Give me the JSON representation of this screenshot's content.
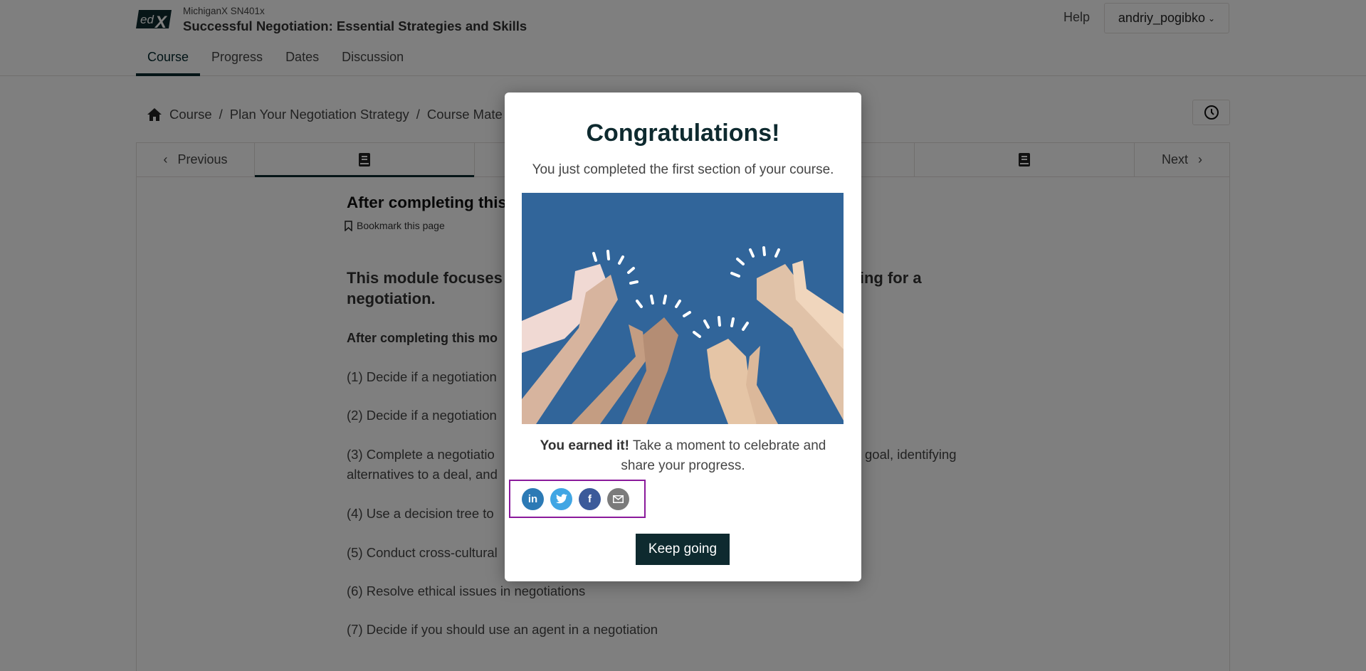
{
  "header": {
    "logo": "edX",
    "course_org": "MichiganX SN401x",
    "course_title": "Successful Negotiation: Essential Strategies and Skills",
    "help_label": "Help",
    "username": "andriy_pogibko"
  },
  "course_tabs": [
    {
      "label": "Course",
      "active": true
    },
    {
      "label": "Progress",
      "active": false
    },
    {
      "label": "Dates",
      "active": false
    },
    {
      "label": "Discussion",
      "active": false
    }
  ],
  "breadcrumb": [
    "Course",
    "Plan Your Negotiation Strategy",
    "Course Mate"
  ],
  "unit_nav": {
    "previous_label": "Previous",
    "next_label": "Next",
    "sequence_icons": [
      "book-icon",
      "unknown",
      "book-icon"
    ]
  },
  "content": {
    "title": "After completing this",
    "bookmark_label": "Bookmark this page",
    "lead_line1_left": "This module focuses",
    "lead_line1_right": "nning for a",
    "lead_line2": "negotiation.",
    "subhead": "After completing this mo",
    "objectives": [
      "(1) Decide if a negotiation",
      "(2) Decide if a negotiation",
      "(3) Complete a negotiatio",
      "(4) Use a decision tree to",
      "(5) Conduct cross-cultural",
      "(6) Resolve ethical issues in negotiations",
      "(7) Decide if you should use an agent in a negotiation"
    ],
    "objective3_right": "goal, identifying",
    "objective3_line2": "alternatives to a deal, and"
  },
  "modal": {
    "title": "Congratulations!",
    "subtitle": "You just completed the first section of your course.",
    "earned_bold": "You earned it!",
    "earned_text": " Take a moment to celebrate and share your progress.",
    "share": [
      {
        "name": "linkedin",
        "glyph": "in"
      },
      {
        "name": "twitter",
        "glyph": ""
      },
      {
        "name": "facebook",
        "glyph": "f"
      },
      {
        "name": "email",
        "glyph": ""
      }
    ],
    "keep_going_label": "Keep going",
    "illustration_bg": "#31659a"
  }
}
